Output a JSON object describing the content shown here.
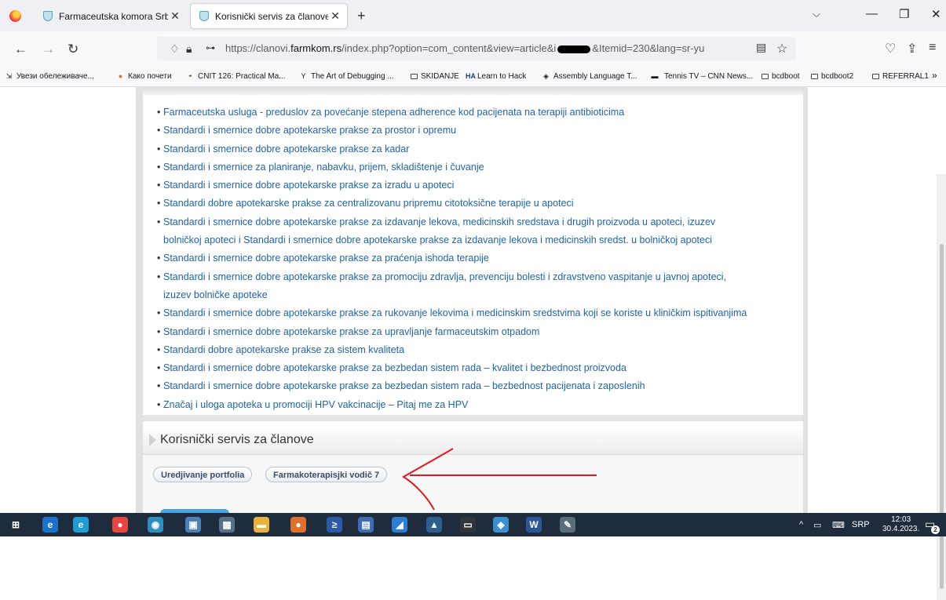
{
  "tabs": [
    {
      "title": "Farmaceutska komora Srbije",
      "close": "✕"
    },
    {
      "title": "Korisnički servis za članove",
      "close": "✕"
    }
  ],
  "new_tab": "+",
  "window": {
    "list_tabs": "⌵",
    "minimize": "—",
    "restore": "❐",
    "close": "✕"
  },
  "nav": {
    "back": "←",
    "forward": "→",
    "reload": "↻"
  },
  "url": {
    "prefix": "https://clanovi.",
    "domain": "farmkom.rs",
    "path": "/index.php?option=com_content&view=article&i",
    "suffix": "&Itemid=230&lang=sr-yu"
  },
  "bookmarks": [
    {
      "label": "Увези обележиваче...",
      "icon": "import-icon"
    },
    {
      "label": "Како почети",
      "icon": "firefox-icon"
    },
    {
      "label": "CNIT 126: Practical Ma...",
      "icon": "site-icon"
    },
    {
      "label": "The Art of Debugging ...",
      "icon": "y-icon"
    },
    {
      "label": "SKIDANJE",
      "icon": "folder-icon"
    },
    {
      "label": "Learn to Hack",
      "icon": "ha-icon"
    },
    {
      "label": "Assembly Language T...",
      "icon": "diamond-icon"
    },
    {
      "label": "Tennis TV – CNN News...",
      "icon": "cnn-icon"
    },
    {
      "label": "bcdboot",
      "icon": "folder-icon"
    },
    {
      "label": "bcdboot2",
      "icon": "folder-icon"
    },
    {
      "label": "REFERRAL1",
      "icon": "folder-icon"
    }
  ],
  "bookmarks_overflow": "»",
  "documents": [
    "Farmaceutska usluga - preduslov za povećanje stepena adherence kod pacijenata na terapiji antibioticima",
    "Standardi i smernice dobre apotekarske prakse za prostor i opremu",
    "Standardi i smernice dobre apotekarske prakse za kadar",
    "Standardi i smernice za planiranje, nabavku, prijem, skladištenje i čuvanje",
    "Standardi i smernice dobre apotekarske prakse za izradu u apoteci",
    "Standardi dobre apotekarske prakse za centralizovanu pripremu citotoksične terapije u apoteci",
    "Standardi i smernice dobre apotekarske prakse za izdavanje lekova, medicinskih sredstava i drugih proizvoda u apoteci, izuzev",
    "bolničkoj apoteci i Standardi i smernice dobre apotekarske prakse za izdavanje lekova i medicinskih sredst. u bolničkoj apoteci",
    "Standardi i smernice dobre apotekarske prakse za praćenja ishoda terapije",
    "Standardi i smernice dobre apotekarske prakse za promociju zdravlja, prevenciju bolesti i zdravstveno vaspitanje u javnoj apoteci,",
    "izuzev bolničke apoteke",
    "Standardi i smernice dobre apotekarske prakse za rukovanje lekovima i medicinskim sredstvima koji se koriste u kliničkim ispitivanjima",
    "Standardi i smernice dobre apotekarske prakse za upravljanje farmaceutskim otpadom",
    "Standardi dobre apotekarske prakse za sistem kvaliteta",
    "Standardi i smernice dobre apotekarske prakse za bezbedan sistem rada – kvalitet i bezbednost proizvoda",
    "Standardi i smernice dobre apotekarske prakse za bezbedan sistem rada – bezbednost pacijenata i zaposlenih",
    "Značaj i uloga apoteka u promociji HPV vakcinacije – Pitaj me za HPV"
  ],
  "section": {
    "title": "Korisnički servis za članove",
    "buttons": [
      "Uredjivanje portfolia",
      "Farmakoterapisjki vodič 7"
    ]
  },
  "taskbar": {
    "apps": [
      {
        "icon": "windows-start-icon",
        "glyph": "⊞",
        "color": "#1f2c3d"
      },
      {
        "icon": "internet-explorer-icon",
        "glyph": "e",
        "color": "#1a73c8"
      },
      {
        "icon": "edge-icon",
        "glyph": "e",
        "color": "#1f9bd6"
      },
      {
        "icon": "chrome-icon",
        "glyph": "●",
        "color": "#e8453c"
      },
      {
        "icon": "network-icon",
        "glyph": "◉",
        "color": "#2c8fbf"
      },
      {
        "icon": "computer-icon",
        "glyph": "▣",
        "color": "#4a7fb8"
      },
      {
        "icon": "calculator-icon",
        "glyph": "▦",
        "color": "#5a6f8a"
      },
      {
        "icon": "file-explorer-icon",
        "glyph": "▬",
        "color": "#e8b23c"
      },
      {
        "icon": "firefox-icon",
        "glyph": "●",
        "color": "#e0702e"
      },
      {
        "icon": "powershell-icon",
        "glyph": "≥",
        "color": "#2b5aa8"
      },
      {
        "icon": "save-disk-icon",
        "glyph": "▤",
        "color": "#3f6db5"
      },
      {
        "icon": "blue-app-icon",
        "glyph": "◢",
        "color": "#2a7fd4"
      },
      {
        "icon": "steam-icon",
        "glyph": "▲",
        "color": "#2d5f8f"
      },
      {
        "icon": "terminal-icon",
        "glyph": "▭",
        "color": "#30353b"
      },
      {
        "icon": "notes-icon",
        "glyph": "◈",
        "color": "#3a8fcf"
      },
      {
        "icon": "word-icon",
        "glyph": "W",
        "color": "#2b579a"
      },
      {
        "icon": "paint-icon",
        "glyph": "✎",
        "color": "#5a6d7a"
      }
    ],
    "tray_arrow": "^",
    "language": "SRP",
    "time": "12:03",
    "date": "30.4.2023.",
    "notification_count": "2"
  }
}
